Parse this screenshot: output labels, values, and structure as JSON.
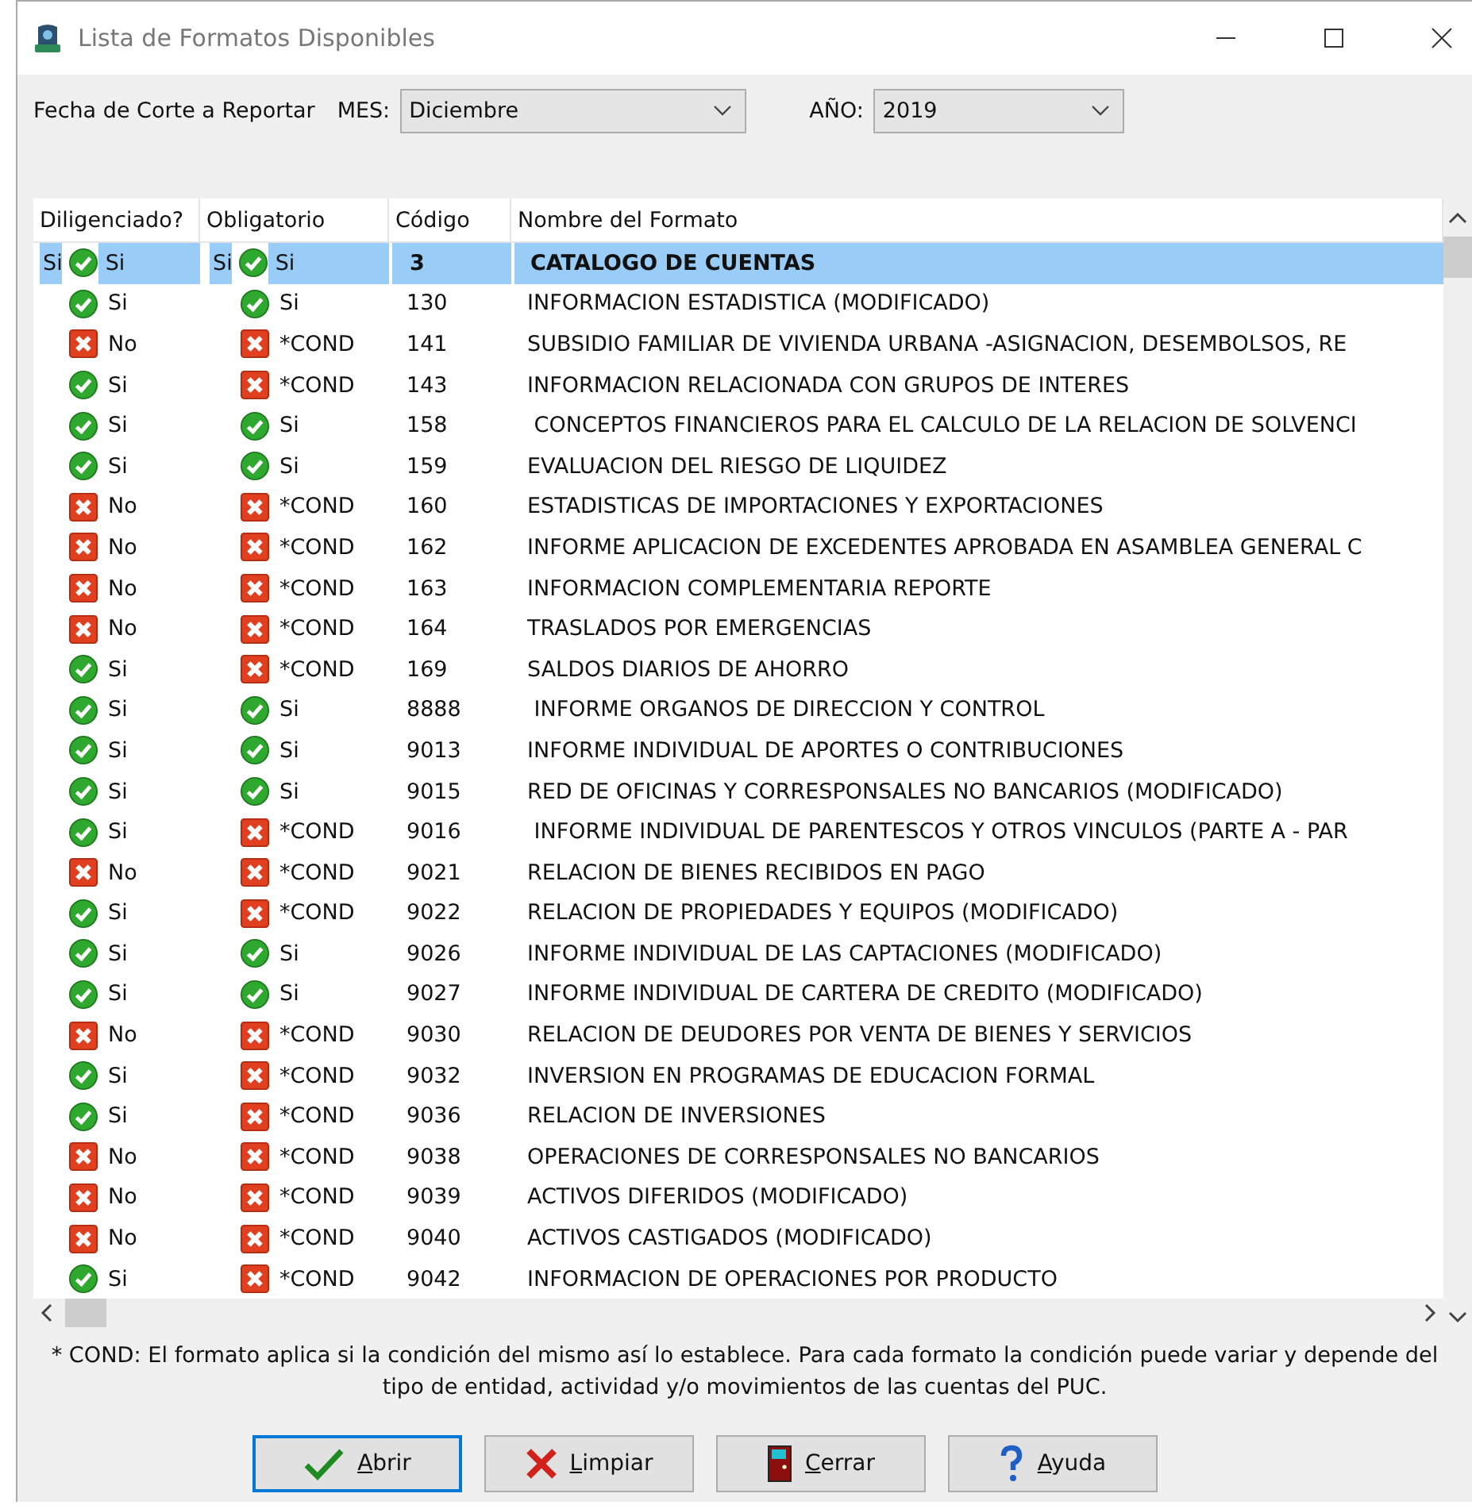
{
  "window": {
    "title": "Lista de Formatos Disponibles"
  },
  "filters": {
    "label": "Fecha de Corte a Reportar",
    "month_label": "MES:",
    "month": "Diciembre",
    "year_label": "AÑO:",
    "year": "2019"
  },
  "table": {
    "columns": [
      "Diligenciado?",
      "Obligatorio",
      "Código",
      "Nombre del Formato"
    ],
    "rows": [
      {
        "selected": true,
        "lead": "Si",
        "dil": {
          "ok": true,
          "text": "Si"
        },
        "obl_lead": "Si",
        "obl": {
          "ok": true,
          "text": "Si"
        },
        "code": "3",
        "name": "CATALOGO DE CUENTAS"
      },
      {
        "selected": false,
        "dil": {
          "ok": true,
          "text": "Si"
        },
        "obl": {
          "ok": true,
          "text": "Si"
        },
        "code": "130",
        "name": "INFORMACION ESTADISTICA (MODIFICADO)"
      },
      {
        "selected": false,
        "dil": {
          "ok": false,
          "text": "No"
        },
        "obl": {
          "ok": false,
          "text": "*COND"
        },
        "code": "141",
        "name": "SUBSIDIO FAMILIAR DE VIVIENDA URBANA -ASIGNACION, DESEMBOLSOS, RE"
      },
      {
        "selected": false,
        "dil": {
          "ok": true,
          "text": "Si"
        },
        "obl": {
          "ok": false,
          "text": "*COND"
        },
        "code": "143",
        "name": "INFORMACION RELACIONADA CON GRUPOS DE INTERES"
      },
      {
        "selected": false,
        "dil": {
          "ok": true,
          "text": "Si"
        },
        "obl": {
          "ok": true,
          "text": "Si"
        },
        "code": "158",
        "name": " CONCEPTOS FINANCIEROS PARA EL CALCULO DE LA RELACION DE SOLVENCI"
      },
      {
        "selected": false,
        "dil": {
          "ok": true,
          "text": "Si"
        },
        "obl": {
          "ok": true,
          "text": "Si"
        },
        "code": "159",
        "name": "EVALUACION DEL RIESGO DE LIQUIDEZ"
      },
      {
        "selected": false,
        "dil": {
          "ok": false,
          "text": "No"
        },
        "obl": {
          "ok": false,
          "text": "*COND"
        },
        "code": "160",
        "name": "ESTADISTICAS DE IMPORTACIONES Y EXPORTACIONES"
      },
      {
        "selected": false,
        "dil": {
          "ok": false,
          "text": "No"
        },
        "obl": {
          "ok": false,
          "text": "*COND"
        },
        "code": "162",
        "name": "INFORME APLICACION DE EXCEDENTES APROBADA EN ASAMBLEA GENERAL C"
      },
      {
        "selected": false,
        "dil": {
          "ok": false,
          "text": "No"
        },
        "obl": {
          "ok": false,
          "text": "*COND"
        },
        "code": "163",
        "name": "INFORMACION COMPLEMENTARIA REPORTE"
      },
      {
        "selected": false,
        "dil": {
          "ok": false,
          "text": "No"
        },
        "obl": {
          "ok": false,
          "text": "*COND"
        },
        "code": "164",
        "name": "TRASLADOS POR EMERGENCIAS"
      },
      {
        "selected": false,
        "dil": {
          "ok": true,
          "text": "Si"
        },
        "obl": {
          "ok": false,
          "text": "*COND"
        },
        "code": "169",
        "name": "SALDOS DIARIOS DE AHORRO"
      },
      {
        "selected": false,
        "dil": {
          "ok": true,
          "text": "Si"
        },
        "obl": {
          "ok": true,
          "text": "Si"
        },
        "code": "8888",
        "name": " INFORME ORGANOS DE DIRECCION Y CONTROL"
      },
      {
        "selected": false,
        "dil": {
          "ok": true,
          "text": "Si"
        },
        "obl": {
          "ok": true,
          "text": "Si"
        },
        "code": "9013",
        "name": "INFORME INDIVIDUAL DE APORTES O CONTRIBUCIONES"
      },
      {
        "selected": false,
        "dil": {
          "ok": true,
          "text": "Si"
        },
        "obl": {
          "ok": true,
          "text": "Si"
        },
        "code": "9015",
        "name": "RED DE OFICINAS Y CORRESPONSALES NO BANCARIOS (MODIFICADO)"
      },
      {
        "selected": false,
        "dil": {
          "ok": true,
          "text": "Si"
        },
        "obl": {
          "ok": false,
          "text": "*COND"
        },
        "code": "9016",
        "name": " INFORME INDIVIDUAL DE PARENTESCOS Y OTROS VINCULOS (PARTE A - PAR"
      },
      {
        "selected": false,
        "dil": {
          "ok": false,
          "text": "No"
        },
        "obl": {
          "ok": false,
          "text": "*COND"
        },
        "code": "9021",
        "name": "RELACION DE BIENES RECIBIDOS EN PAGO"
      },
      {
        "selected": false,
        "dil": {
          "ok": true,
          "text": "Si"
        },
        "obl": {
          "ok": false,
          "text": "*COND"
        },
        "code": "9022",
        "name": "RELACION DE PROPIEDADES Y EQUIPOS (MODIFICADO)"
      },
      {
        "selected": false,
        "dil": {
          "ok": true,
          "text": "Si"
        },
        "obl": {
          "ok": true,
          "text": "Si"
        },
        "code": "9026",
        "name": "INFORME INDIVIDUAL DE LAS CAPTACIONES (MODIFICADO)"
      },
      {
        "selected": false,
        "dil": {
          "ok": true,
          "text": "Si"
        },
        "obl": {
          "ok": true,
          "text": "Si"
        },
        "code": "9027",
        "name": "INFORME INDIVIDUAL DE CARTERA DE CREDITO (MODIFICADO)"
      },
      {
        "selected": false,
        "dil": {
          "ok": false,
          "text": "No"
        },
        "obl": {
          "ok": false,
          "text": "*COND"
        },
        "code": "9030",
        "name": "RELACION DE DEUDORES POR VENTA DE BIENES Y SERVICIOS"
      },
      {
        "selected": false,
        "dil": {
          "ok": true,
          "text": "Si"
        },
        "obl": {
          "ok": false,
          "text": "*COND"
        },
        "code": "9032",
        "name": "INVERSION EN PROGRAMAS DE EDUCACION FORMAL"
      },
      {
        "selected": false,
        "dil": {
          "ok": true,
          "text": "Si"
        },
        "obl": {
          "ok": false,
          "text": "*COND"
        },
        "code": "9036",
        "name": "RELACION DE INVERSIONES"
      },
      {
        "selected": false,
        "dil": {
          "ok": false,
          "text": "No"
        },
        "obl": {
          "ok": false,
          "text": "*COND"
        },
        "code": "9038",
        "name": "OPERACIONES DE CORRESPONSALES NO BANCARIOS"
      },
      {
        "selected": false,
        "dil": {
          "ok": false,
          "text": "No"
        },
        "obl": {
          "ok": false,
          "text": "*COND"
        },
        "code": "9039",
        "name": "ACTIVOS DIFERIDOS (MODIFICADO)"
      },
      {
        "selected": false,
        "dil": {
          "ok": false,
          "text": "No"
        },
        "obl": {
          "ok": false,
          "text": "*COND"
        },
        "code": "9040",
        "name": "ACTIVOS CASTIGADOS (MODIFICADO)"
      },
      {
        "selected": false,
        "dil": {
          "ok": true,
          "text": "Si"
        },
        "obl": {
          "ok": false,
          "text": "*COND"
        },
        "code": "9042",
        "name": "INFORMACION DE OPERACIONES POR PRODUCTO"
      }
    ]
  },
  "footnote": "* COND: El formato aplica si la condición del mismo así lo establece. Para cada formato la condición puede variar y depende del tipo de entidad, actividad y/o movimientos de las cuentas del PUC.",
  "buttons": [
    {
      "kind": "open",
      "label": "Abrir",
      "selected": true
    },
    {
      "kind": "clear",
      "label": "Limpiar",
      "selected": false
    },
    {
      "kind": "close",
      "label": "Cerrar",
      "selected": false
    },
    {
      "kind": "help",
      "label": "Ayuda",
      "selected": false
    }
  ]
}
